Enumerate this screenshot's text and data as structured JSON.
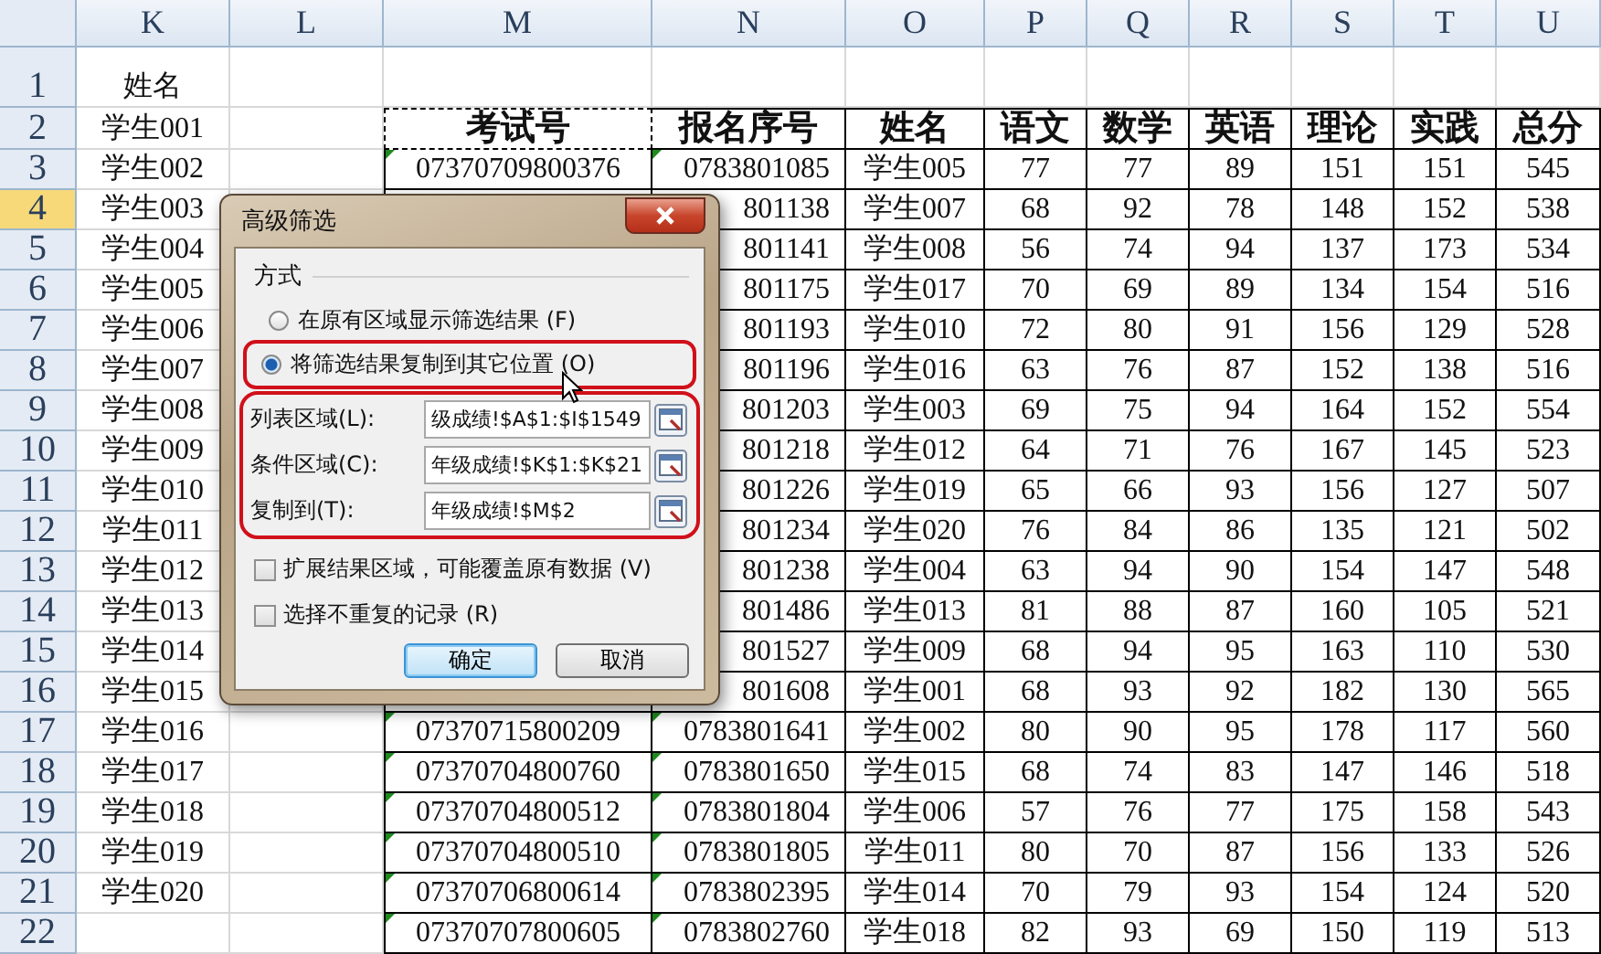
{
  "sheet": {
    "columns": [
      "K",
      "L",
      "M",
      "N",
      "O",
      "P",
      "Q",
      "R",
      "S",
      "T",
      "U"
    ],
    "rows": [
      {
        "number": "1",
        "selected": false,
        "kind": "title",
        "cells": {
          "K": "姓名"
        }
      },
      {
        "number": "2",
        "selected": false,
        "kind": "header",
        "marquee": true,
        "cells": {
          "K": "学生001",
          "M": "考试号",
          "N": "报名序号",
          "O": "姓名",
          "P": "语文",
          "Q": "数学",
          "R": "英语",
          "S": "理论",
          "T": "实践",
          "U": "总分"
        }
      },
      {
        "number": "3",
        "selected": false,
        "kind": "data",
        "cells": {
          "K": "学生002",
          "M": "07370709800376",
          "N": "0783801085",
          "O": "学生005",
          "P": "77",
          "Q": "77",
          "R": "89",
          "S": "151",
          "T": "151",
          "U": "545"
        }
      },
      {
        "number": "4",
        "selected": true,
        "kind": "data",
        "cells": {
          "K": "学生003",
          "N": "801138",
          "O": "学生007",
          "P": "68",
          "Q": "92",
          "R": "78",
          "S": "148",
          "T": "152",
          "U": "538"
        }
      },
      {
        "number": "5",
        "selected": false,
        "kind": "data",
        "cells": {
          "K": "学生004",
          "N": "801141",
          "O": "学生008",
          "P": "56",
          "Q": "74",
          "R": "94",
          "S": "137",
          "T": "173",
          "U": "534"
        }
      },
      {
        "number": "6",
        "selected": false,
        "kind": "data",
        "cells": {
          "K": "学生005",
          "N": "801175",
          "O": "学生017",
          "P": "70",
          "Q": "69",
          "R": "89",
          "S": "134",
          "T": "154",
          "U": "516"
        }
      },
      {
        "number": "7",
        "selected": false,
        "kind": "data",
        "cells": {
          "K": "学生006",
          "N": "801193",
          "O": "学生010",
          "P": "72",
          "Q": "80",
          "R": "91",
          "S": "156",
          "T": "129",
          "U": "528"
        }
      },
      {
        "number": "8",
        "selected": false,
        "kind": "data",
        "cells": {
          "K": "学生007",
          "N": "801196",
          "O": "学生016",
          "P": "63",
          "Q": "76",
          "R": "87",
          "S": "152",
          "T": "138",
          "U": "516"
        }
      },
      {
        "number": "9",
        "selected": false,
        "kind": "data",
        "cells": {
          "K": "学生008",
          "N": "801203",
          "O": "学生003",
          "P": "69",
          "Q": "75",
          "R": "94",
          "S": "164",
          "T": "152",
          "U": "554"
        }
      },
      {
        "number": "10",
        "selected": false,
        "kind": "data",
        "cells": {
          "K": "学生009",
          "N": "801218",
          "O": "学生012",
          "P": "64",
          "Q": "71",
          "R": "76",
          "S": "167",
          "T": "145",
          "U": "523"
        }
      },
      {
        "number": "11",
        "selected": false,
        "kind": "data",
        "cells": {
          "K": "学生010",
          "N": "801226",
          "O": "学生019",
          "P": "65",
          "Q": "66",
          "R": "93",
          "S": "156",
          "T": "127",
          "U": "507"
        }
      },
      {
        "number": "12",
        "selected": false,
        "kind": "data",
        "cells": {
          "K": "学生011",
          "N": "801234",
          "O": "学生020",
          "P": "76",
          "Q": "84",
          "R": "86",
          "S": "135",
          "T": "121",
          "U": "502"
        }
      },
      {
        "number": "13",
        "selected": false,
        "kind": "data",
        "cells": {
          "K": "学生012",
          "N": "801238",
          "O": "学生004",
          "P": "63",
          "Q": "94",
          "R": "90",
          "S": "154",
          "T": "147",
          "U": "548"
        }
      },
      {
        "number": "14",
        "selected": false,
        "kind": "data",
        "cells": {
          "K": "学生013",
          "N": "801486",
          "O": "学生013",
          "P": "81",
          "Q": "88",
          "R": "87",
          "S": "160",
          "T": "105",
          "U": "521"
        }
      },
      {
        "number": "15",
        "selected": false,
        "kind": "data",
        "cells": {
          "K": "学生014",
          "N": "801527",
          "O": "学生009",
          "P": "68",
          "Q": "94",
          "R": "95",
          "S": "163",
          "T": "110",
          "U": "530"
        }
      },
      {
        "number": "16",
        "selected": false,
        "kind": "data",
        "cells": {
          "K": "学生015",
          "N": "801608",
          "O": "学生001",
          "P": "68",
          "Q": "93",
          "R": "92",
          "S": "182",
          "T": "130",
          "U": "565"
        }
      },
      {
        "number": "17",
        "selected": false,
        "kind": "data",
        "cells": {
          "K": "学生016",
          "M": "07370715800209",
          "N": "0783801641",
          "O": "学生002",
          "P": "80",
          "Q": "90",
          "R": "95",
          "S": "178",
          "T": "117",
          "U": "560"
        }
      },
      {
        "number": "18",
        "selected": false,
        "kind": "data",
        "cells": {
          "K": "学生017",
          "M": "07370704800760",
          "N": "0783801650",
          "O": "学生015",
          "P": "68",
          "Q": "74",
          "R": "83",
          "S": "147",
          "T": "146",
          "U": "518"
        }
      },
      {
        "number": "19",
        "selected": false,
        "kind": "data",
        "cells": {
          "K": "学生018",
          "M": "07370704800512",
          "N": "0783801804",
          "O": "学生006",
          "P": "57",
          "Q": "76",
          "R": "77",
          "S": "175",
          "T": "158",
          "U": "543"
        }
      },
      {
        "number": "20",
        "selected": false,
        "kind": "data",
        "cells": {
          "K": "学生019",
          "M": "07370704800510",
          "N": "0783801805",
          "O": "学生011",
          "P": "80",
          "Q": "70",
          "R": "87",
          "S": "156",
          "T": "133",
          "U": "526"
        }
      },
      {
        "number": "21",
        "selected": false,
        "kind": "data",
        "cells": {
          "K": "学生020",
          "M": "07370706800614",
          "N": "0783802395",
          "O": "学生014",
          "P": "70",
          "Q": "79",
          "R": "93",
          "S": "154",
          "T": "124",
          "U": "520"
        }
      },
      {
        "number": "22",
        "selected": false,
        "kind": "data",
        "cells": {
          "M": "07370707800605",
          "N": "0783802760",
          "O": "学生018",
          "P": "82",
          "Q": "93",
          "R": "69",
          "S": "150",
          "T": "119",
          "U": "513"
        }
      }
    ]
  },
  "dialog": {
    "title": "高级筛选",
    "group_label": "方式",
    "options": [
      {
        "label": "在原有区域显示筛选结果 (F)",
        "selected": false,
        "highlighted": false
      },
      {
        "label": "将筛选结果复制到其它位置 (O)",
        "selected": true,
        "highlighted": true
      }
    ],
    "fields_highlighted": true,
    "fields": [
      {
        "label": "列表区域(L):",
        "value": "级成绩!$A$1:$I$1549"
      },
      {
        "label": "条件区域(C):",
        "value": "年级成绩!$K$1:$K$21"
      },
      {
        "label": "复制到(T):",
        "value": "年级成绩!$M$2"
      }
    ],
    "checkboxes": [
      {
        "label": "扩展结果区域，可能覆盖原有数据 (V)",
        "checked": false
      },
      {
        "label": "选择不重复的记录 (R)",
        "checked": false
      }
    ],
    "buttons": [
      {
        "label": "确定",
        "default": true
      },
      {
        "label": "取消",
        "default": false
      }
    ]
  }
}
